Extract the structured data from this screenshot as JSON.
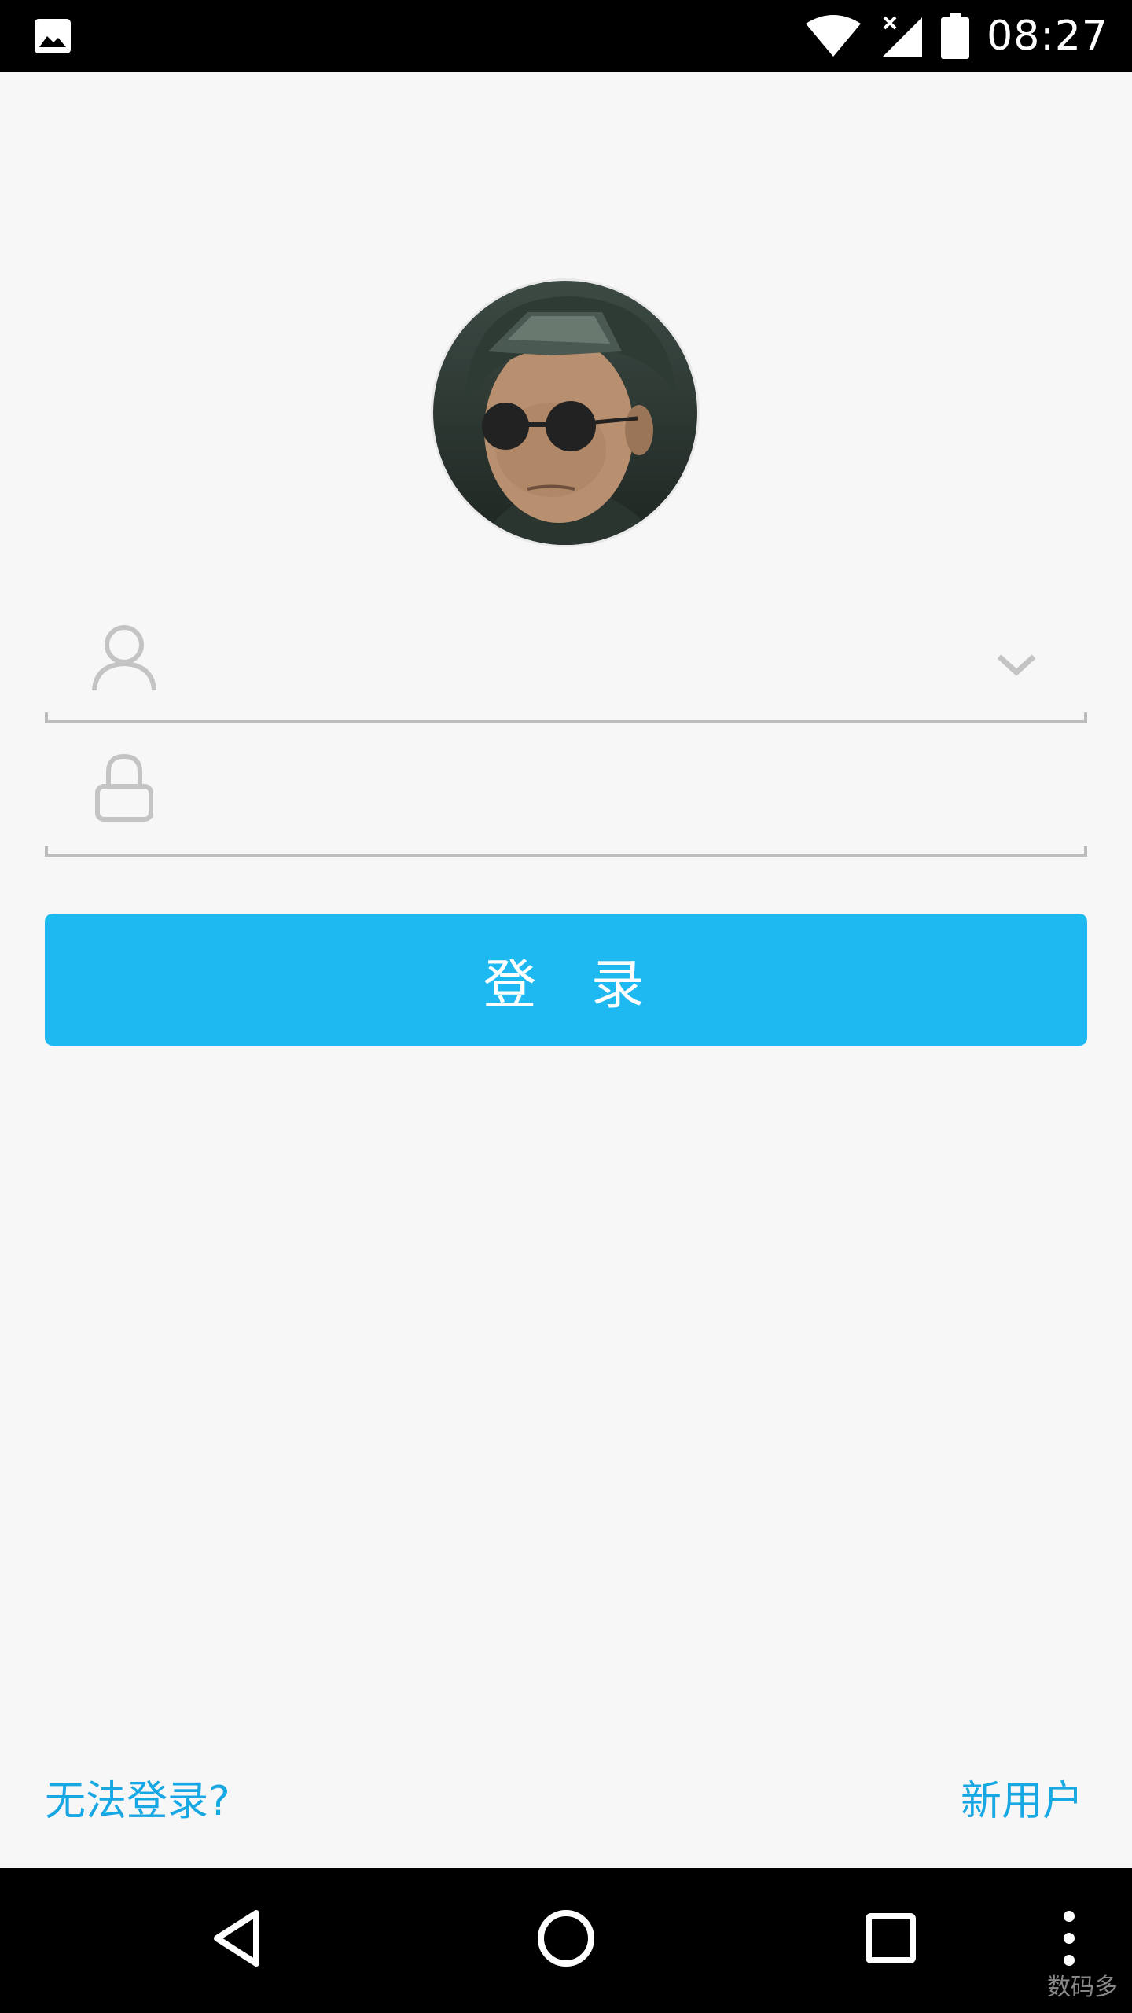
{
  "status_bar": {
    "time": "08:27",
    "icons": [
      "image-icon",
      "wifi-icon",
      "signal-icon",
      "battery-icon"
    ]
  },
  "login": {
    "avatar": "avatar-photo",
    "username": {
      "value": "",
      "placeholder": "",
      "icon": "user-icon",
      "trailing_icon": "chevron-down-icon"
    },
    "password": {
      "value": "",
      "placeholder": "",
      "icon": "lock-icon"
    },
    "submit_label": "登 录"
  },
  "footer": {
    "cant_login": "无法登录?",
    "new_user": "新用户"
  },
  "nav_bar": {
    "buttons": [
      "back-icon",
      "home-icon",
      "recents-icon",
      "overflow-menu-icon"
    ]
  },
  "watermark": "数码多",
  "colors": {
    "accent": "#1fb9f2",
    "link": "#17a8e3",
    "background": "#f7f7f7",
    "underline": "#bdbdbd",
    "icon_gray": "#c4c4c4"
  }
}
